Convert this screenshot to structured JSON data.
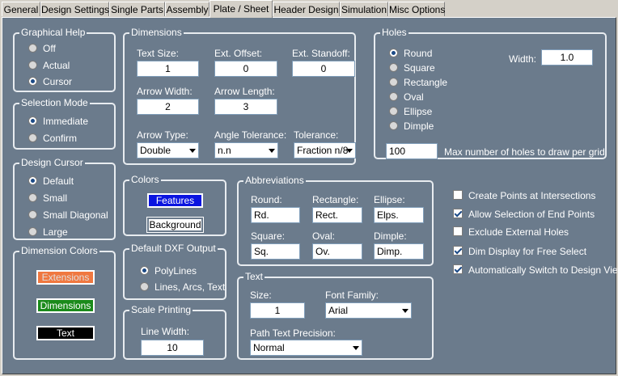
{
  "tabs": [
    "General",
    "Design Settings",
    "Single Parts",
    "Assembly",
    "Plate / Sheet",
    "Header Design",
    "Simulation",
    "Misc Options"
  ],
  "graphical_help": {
    "title": "Graphical Help",
    "options": [
      "Off",
      "Actual",
      "Cursor"
    ],
    "selected": "Cursor"
  },
  "selection_mode": {
    "title": "Selection Mode",
    "options": [
      "Immediate",
      "Confirm"
    ],
    "selected": "Immediate"
  },
  "design_cursor": {
    "title": "Design Cursor",
    "options": [
      "Default",
      "Small",
      "Small Diagonal",
      "Large"
    ],
    "selected": "Default"
  },
  "dimension_colors": {
    "title": "Dimension Colors",
    "extensions": "Extensions",
    "dimensions": "Dimensions",
    "text": "Text",
    "extensions_color": "#f07840",
    "dimensions_color": "#1a8a1a",
    "text_color": "#000000"
  },
  "dimensions": {
    "title": "Dimensions",
    "text_size_label": "Text Size:",
    "text_size": "1",
    "ext_offset_label": "Ext. Offset:",
    "ext_offset": "0",
    "ext_standoff_label": "Ext. Standoff:",
    "ext_standoff": "0",
    "arrow_width_label": "Arrow Width:",
    "arrow_width": "2",
    "arrow_length_label": "Arrow Length:",
    "arrow_length": "3",
    "arrow_type_label": "Arrow Type:",
    "arrow_type": "Double",
    "angle_tolerance_label": "Angle Tolerance:",
    "angle_tolerance": "n.n",
    "tolerance_label": "Tolerance:",
    "tolerance": "Fraction n/8"
  },
  "colors": {
    "title": "Colors",
    "features": "Features",
    "background": "Background",
    "features_color": "#0a14e0"
  },
  "dxf_output": {
    "title": "Default DXF Output",
    "options": [
      "PolyLines",
      "Lines, Arcs, Text"
    ],
    "selected": "PolyLines"
  },
  "scale_printing": {
    "title": "Scale Printing",
    "line_width_label": "Line Width:",
    "line_width": "10"
  },
  "holes": {
    "title": "Holes",
    "options": [
      "Round",
      "Square",
      "Rectangle",
      "Oval",
      "Ellipse",
      "Dimple"
    ],
    "selected": "Round",
    "width_label": "Width:",
    "width": "1.0",
    "max_holes": "100",
    "max_holes_label": "Max number of holes to draw per grid"
  },
  "abbreviations": {
    "title": "Abbreviations",
    "round_label": "Round:",
    "round": "Rd.",
    "rectangle_label": "Rectangle:",
    "rectangle": "Rect.",
    "ellipse_label": "Ellipse:",
    "ellipse": "Elps.",
    "square_label": "Square:",
    "square": "Sq.",
    "oval_label": "Oval:",
    "oval": "Ov.",
    "dimple_label": "Dimple:",
    "dimple": "Dimp."
  },
  "text": {
    "title": "Text",
    "size_label": "Size:",
    "size": "1",
    "font_family_label": "Font Family:",
    "font_family": "Arial",
    "path_precision_label": "Path Text Precision:",
    "path_precision": "Normal"
  },
  "options": [
    {
      "label": "Create Points at Intersections",
      "checked": false
    },
    {
      "label": "Allow Selection of End Points",
      "checked": true
    },
    {
      "label": "Exclude External Holes",
      "checked": false
    },
    {
      "label": "Dim Display for Free Select",
      "checked": true
    },
    {
      "label": "Automatically Switch to Design View",
      "checked": true
    }
  ]
}
